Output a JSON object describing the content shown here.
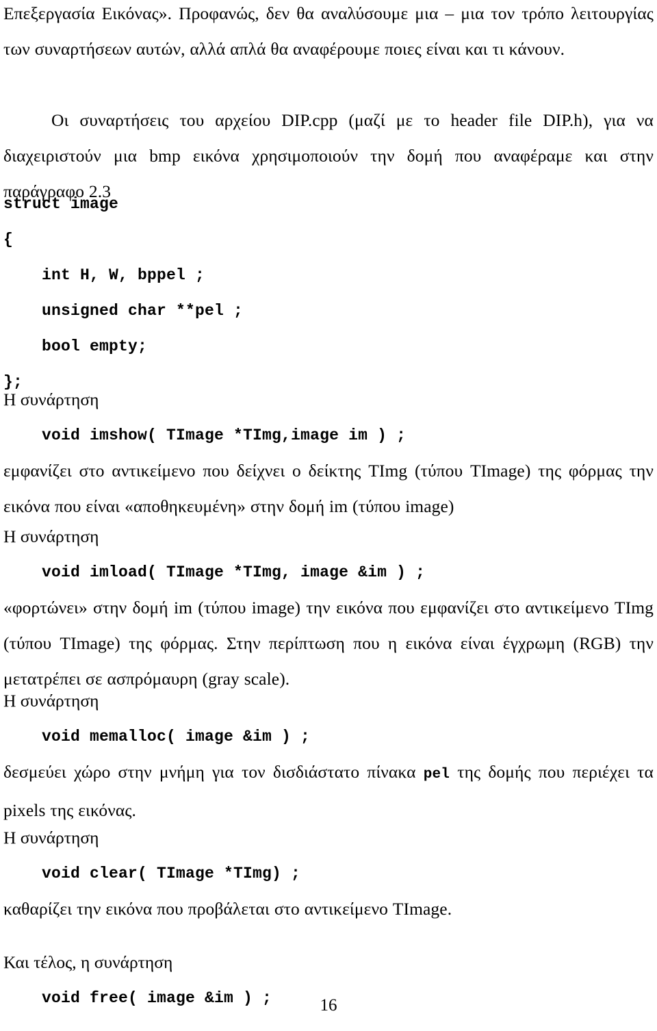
{
  "document": {
    "language": "Greek",
    "page_number": "16"
  },
  "intro": {
    "paragraph_1": "Επεξεργασία Εικόνας». Προφανώς, δεν θα αναλύσουμε μια – μια τον τρόπο λειτουργίας των συναρτήσεων αυτών, αλλά απλά θα αναφέρουμε ποιες είναι και τι κάνουν.",
    "paragraph_2": "Οι συναρτήσεις του αρχείου DIP.cpp (μαζί με το header file DIP.h), για να διαχειριστούν μια bmp εικόνα χρησιμοποιούν την δομή που αναφέραμε και στην παράγραφο 2.3"
  },
  "struct_block": {
    "lines": [
      "struct image",
      "{",
      "    int H, W, bppel ;",
      "    unsigned char **pel ;",
      "    bool empty;",
      "};"
    ]
  },
  "sections": [
    {
      "label": "Η συνάρτηση",
      "signature": "void imshow( TImage *TImg,image im ) ;",
      "description": "εμφανίζει στο αντικείμενο που δείχνει ο δείκτης TImg (τύπου TImage) της φόρμας την εικόνα που είναι «αποθηκευμένη» στην δομή im (τύπου image)"
    },
    {
      "label": "Η συνάρτηση",
      "signature": "void imload( TImage *TImg, image &im ) ;",
      "description": "«φορτώνει» στην δομή im (τύπου image) την εικόνα που εμφανίζει στο αντικείμενο TImg (τύπου TImage) της φόρμας. Στην περίπτωση που η εικόνα είναι έγχρωμη (RGB) την μετατρέπει σε ασπρόμαυρη (gray scale)."
    },
    {
      "label": "Η συνάρτηση",
      "signature": "void memalloc( image &im ) ;",
      "description_before_code": "δεσμεύει χώρο στην μνήμη για τον δισδιάστατο πίνακα ",
      "description_code": "pel",
      "description_after_code": " της δομής που περιέχει τα pixels της εικόνας."
    },
    {
      "label": "Η συνάρτηση",
      "signature": "void clear( TImage *TImg) ;",
      "description": "καθαρίζει την εικόνα που προβάλεται στο αντικείμενο TImage."
    },
    {
      "label": "Και τέλος, η συνάρτηση",
      "signature": "void free( image &im ) ;",
      "description": ""
    }
  ]
}
